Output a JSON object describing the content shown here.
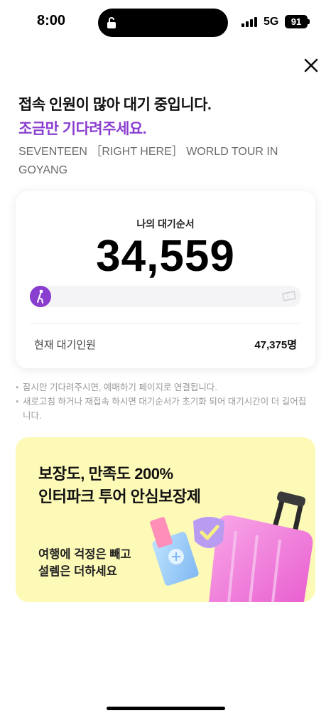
{
  "status_bar": {
    "time": "8:00",
    "network": "5G",
    "battery": "91"
  },
  "header": {
    "close_icon": "close-icon"
  },
  "notice": {
    "headline": "접속 인원이 많아 대기 중입니다.",
    "subline": "조금만 기다려주세요.",
    "event_title": "SEVENTEEN ［RIGHT HERE］ WORLD TOUR IN GOYANG"
  },
  "queue": {
    "label": "나의 대기순서",
    "position": "34,559",
    "current_label": "현재 대기인원",
    "current_value": "47,375명",
    "progress_fraction": 0.0
  },
  "notes": [
    "잠시만 기다려주시면, 예매하기 페이지로 연결됩니다.",
    "새로고침 하거나 재접속 하시면 대기순서가 초기화 되어 대기시간이 더 길어집니다."
  ],
  "banner": {
    "headline_line1": "보장도, 만족도 200%",
    "headline_line2": "인터파크 투어 안심보장제",
    "sub_line1": "여행에 걱정은 빼고",
    "sub_line2": "설렘은 더하세요",
    "accent_color": "#fdfab8"
  },
  "colors": {
    "accent": "#8a3ed0"
  }
}
